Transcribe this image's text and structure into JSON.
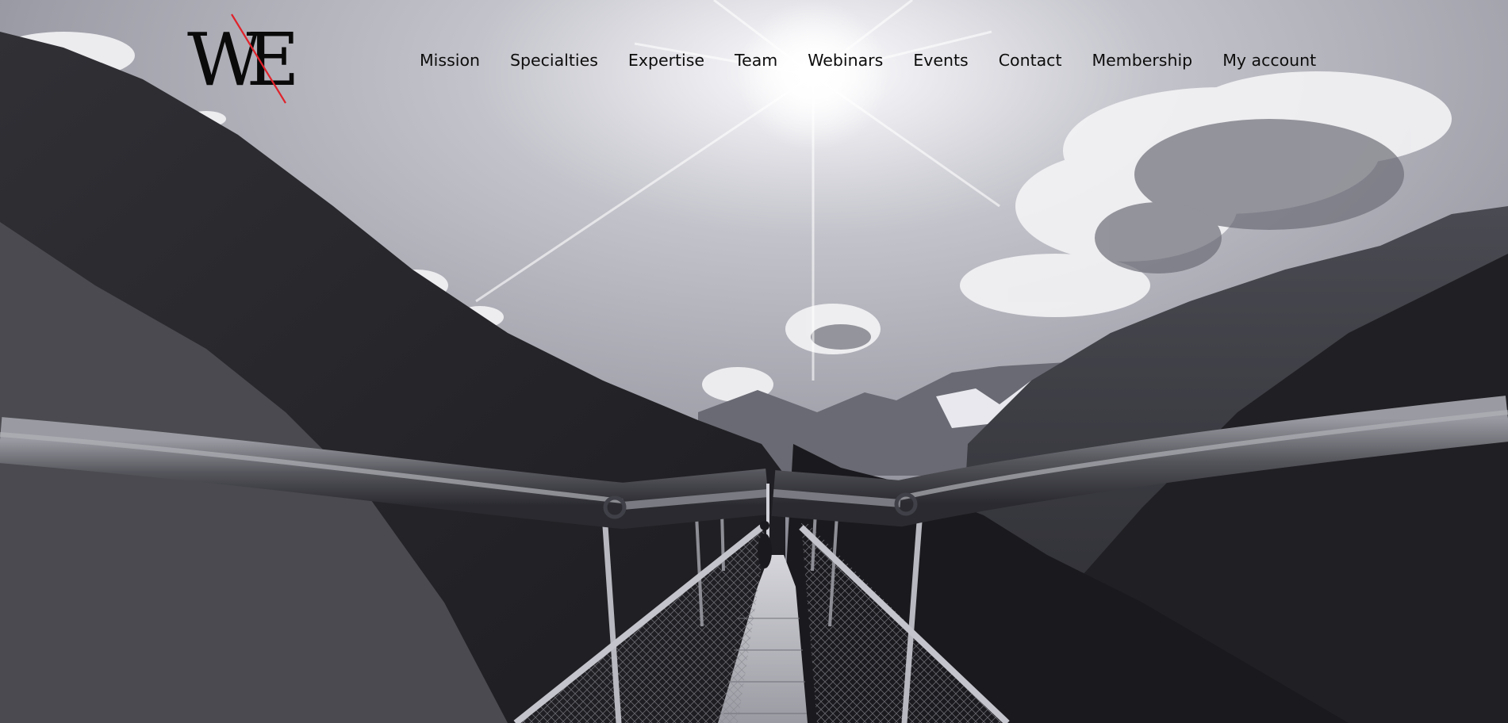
{
  "logo": {
    "text": "WE",
    "slash_color": "#e0222a"
  },
  "nav": {
    "items": [
      {
        "label": "Mission"
      },
      {
        "label": "Specialties"
      },
      {
        "label": "Expertise"
      },
      {
        "label": "Team"
      },
      {
        "label": "Webinars"
      },
      {
        "label": "Events"
      },
      {
        "label": "Contact"
      },
      {
        "label": "Membership"
      },
      {
        "label": "My account"
      }
    ]
  },
  "hero": {
    "image": "black-and-white suspension bridge over forested mountain valley with bright sun"
  }
}
